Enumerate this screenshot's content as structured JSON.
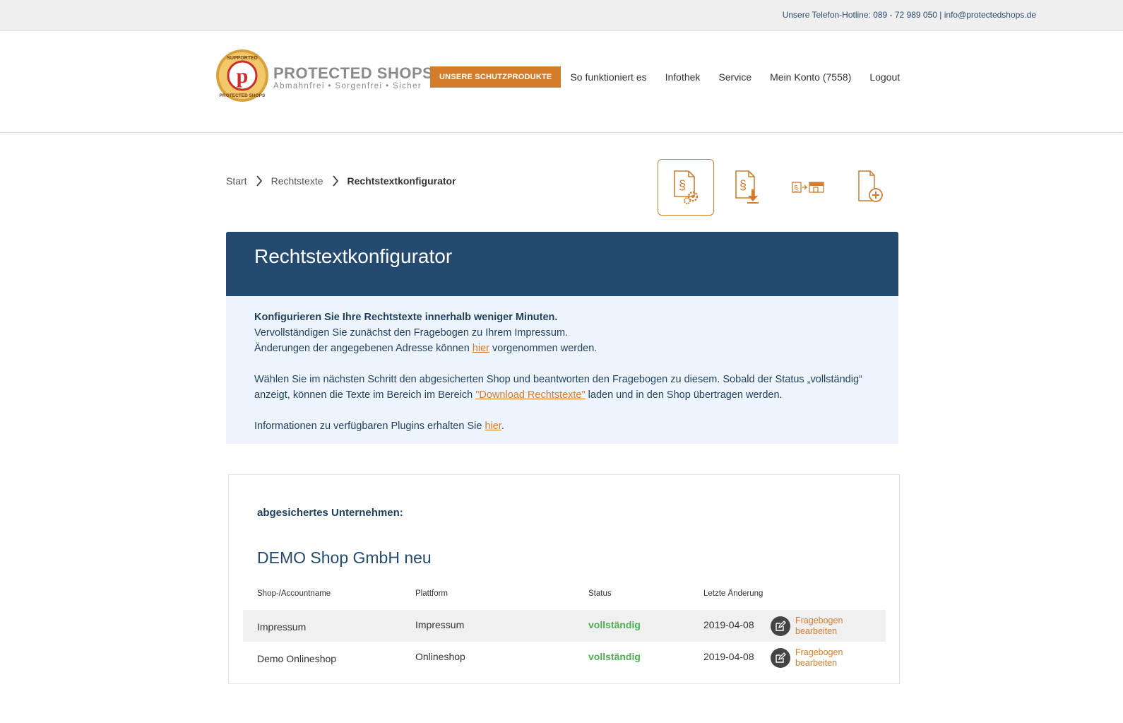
{
  "topbar": {
    "hotline": "Unsere Telefon-Hotline: 089 - 72 989 050 | info@protectedshops.de"
  },
  "logo": {
    "title": "PROTECTED SHOPS",
    "tagline": "Abmahnfrei • Sorgenfrei • Sicher",
    "badge_top": "SUPPORTED",
    "badge_bottom": "PROTECTED SHOPS",
    "badge_letter": "p"
  },
  "nav": {
    "cta": "UNSERE SCHUTZPRODUKTE",
    "items": [
      "So funktioniert es",
      "Infothek",
      "Service",
      "Mein Konto (7558)",
      "Logout"
    ]
  },
  "breadcrumb": {
    "items": [
      "Start",
      "Rechtstexte"
    ],
    "current": "Rechtstextkonfigurator"
  },
  "tools": {
    "icons": [
      "legal-text-config-icon",
      "legal-text-download-icon",
      "legal-text-shop-icon",
      "document-add-icon"
    ]
  },
  "panel": {
    "title": "Rechtstextkonfigurator",
    "p1_bold": "Konfigurieren Sie Ihre Rechtstexte innerhalb weniger Minuten.",
    "p1_line2": "Vervollständigen Sie zunächst den Fragebogen zu Ihrem Impressum.",
    "p1_line3_pre": "Änderungen der angegebenen Adresse können ",
    "p1_link": "hier",
    "p1_line3_post": " vorgenommen werden.",
    "p2_pre": "Wählen Sie im nächsten Schritt den abgesicherten Shop und beantworten den Fragebogen zu diesem. Sobald der Status „vollständig“ anzeigt, können die Texte im Bereich im Bereich ",
    "p2_link": "\"Download Rechtstexte\"",
    "p2_post": " laden und in den Shop übertragen werden.",
    "p3_pre": "Informationen zu verfügbaren Plugins erhalten Sie ",
    "p3_link": "hier",
    "p3_post": "."
  },
  "company": {
    "label": "abgesichertes Unternehmen:",
    "name": "DEMO Shop GmbH neu",
    "columns": [
      "Shop-/Accountname",
      "Plattform",
      "Status",
      "Letzte Änderung"
    ],
    "rows": [
      {
        "name": "Impressum",
        "platform": "Impressum",
        "status": "vollständig",
        "date": "2019-04-08",
        "action": "Fragebogen bearbeiten"
      },
      {
        "name": "Demo Onlineshop",
        "platform": "Onlineshop",
        "status": "vollständig",
        "date": "2019-04-08",
        "action": "Fragebogen bearbeiten"
      }
    ]
  },
  "colors": {
    "accent": "#d37d2c",
    "navy": "#244a6f",
    "status_ok": "#4caf50",
    "info_bg": "#eef4fb"
  }
}
